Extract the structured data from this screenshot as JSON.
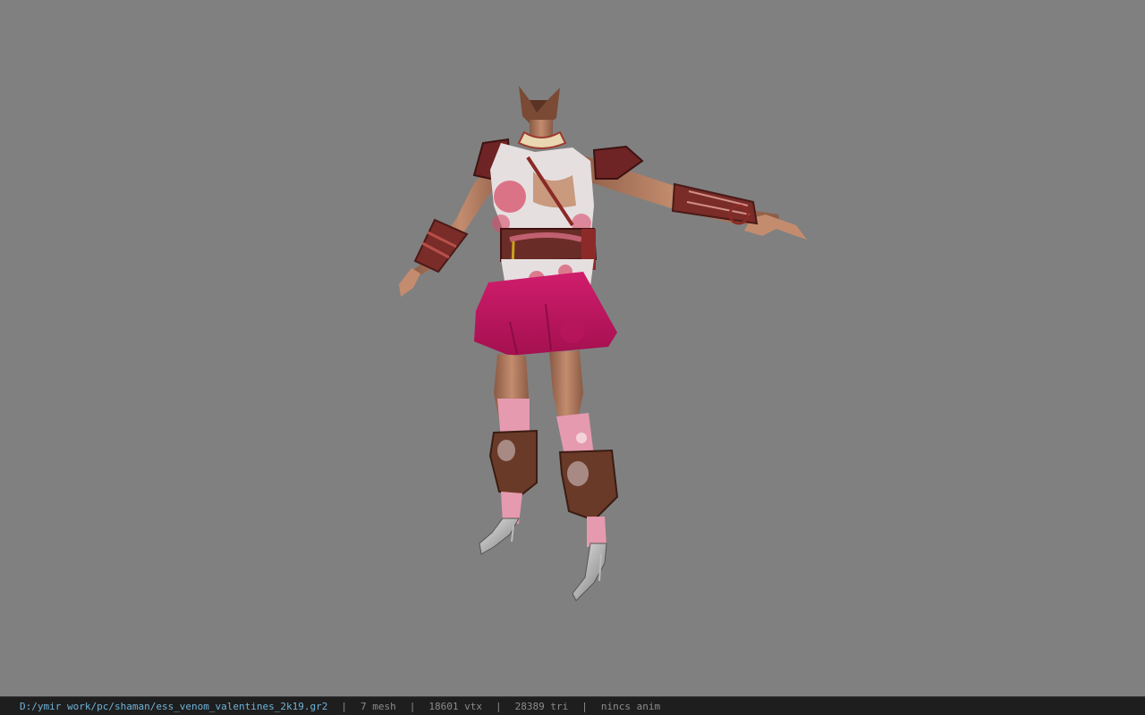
{
  "viewer": {
    "background_color": "#808080",
    "model_name": "ess_venom_valentines_2k19"
  },
  "status_bar": {
    "file_path": "D:/ymir work/pc/shaman/ess_venom_valentines_2k19.gr2",
    "separator": "|",
    "mesh_count": "7 mesh",
    "vertex_count": "18601 vtx",
    "triangle_count": "28389 tri",
    "animation": "nincs anim",
    "path_color": "#6fb3d8",
    "text_color": "#8c8c8c"
  }
}
